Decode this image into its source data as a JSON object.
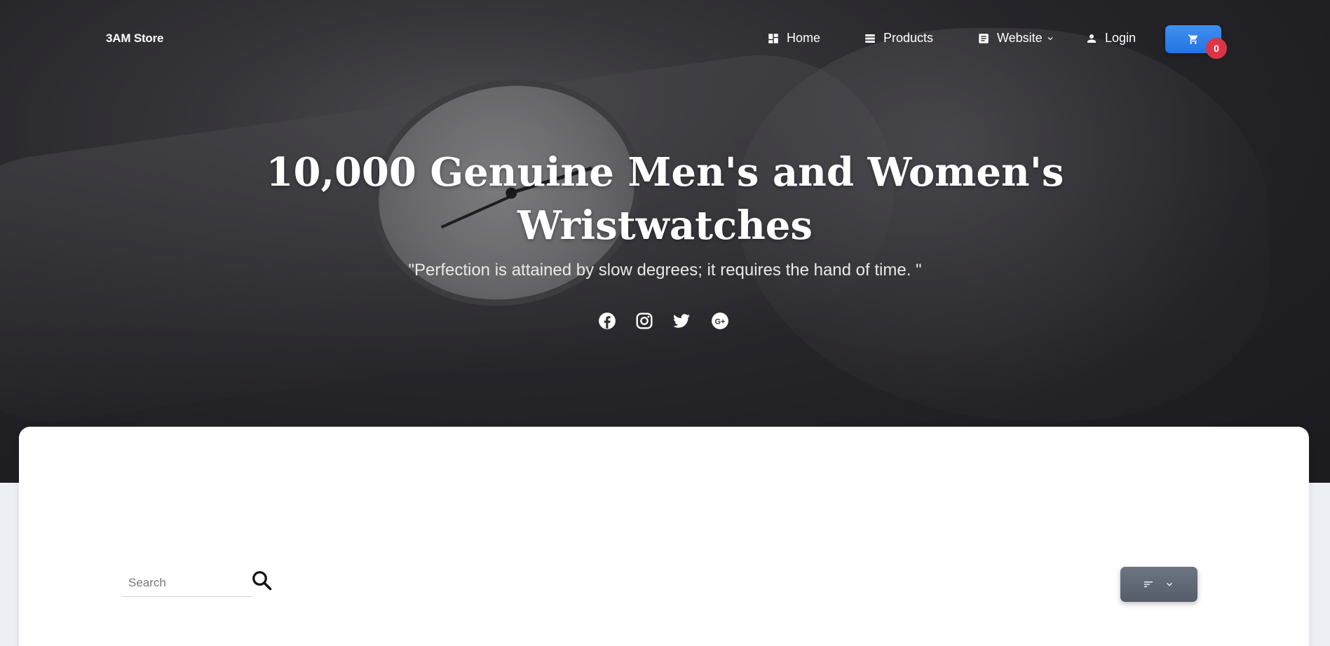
{
  "brand": {
    "name": "3AM Store"
  },
  "nav": {
    "items": [
      {
        "label": "Home",
        "icon": "dashboard-icon"
      },
      {
        "label": "Products",
        "icon": "products-list-icon"
      },
      {
        "label": "Website",
        "icon": "document-icon",
        "has_dropdown": true
      },
      {
        "label": "Login",
        "icon": "user-icon"
      }
    ],
    "cart": {
      "icon": "cart-icon",
      "count": "0",
      "accent": "#2b7de9",
      "badge_color": "#dc3545"
    }
  },
  "hero": {
    "title_line1": "10,000 Genuine Men's and Women's",
    "title_line2": "Wristwatches",
    "quote": "\"Perfection is attained by slow degrees; it requires the hand of time. \"",
    "social": [
      "facebook-icon",
      "instagram-icon",
      "twitter-icon",
      "google-plus-icon"
    ]
  },
  "search": {
    "placeholder": "Search",
    "value": ""
  },
  "sort": {
    "icon": "sort-icon"
  }
}
